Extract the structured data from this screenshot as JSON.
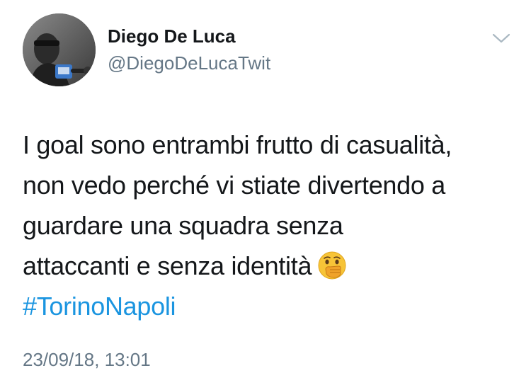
{
  "tweet": {
    "author": {
      "display_name": "Diego De Luca",
      "handle": "@DiegoDeLucaTwit",
      "avatar_icon": "profile-photo"
    },
    "menu_icon": "chevron-down-icon",
    "text_lines": [
      "I goal sono entrambi frutto di casualità,",
      "non vedo perché vi stiate divertendo a",
      "guardare una squadra senza",
      "attaccanti e senza identità"
    ],
    "emoji": "face-with-hand-over-mouth",
    "hashtag": "#TorinoNapoli",
    "timestamp": "23/09/18, 13:01"
  },
  "colors": {
    "text": "#14171a",
    "secondary": "#657786",
    "link": "#1b95e0",
    "background": "#ffffff"
  }
}
